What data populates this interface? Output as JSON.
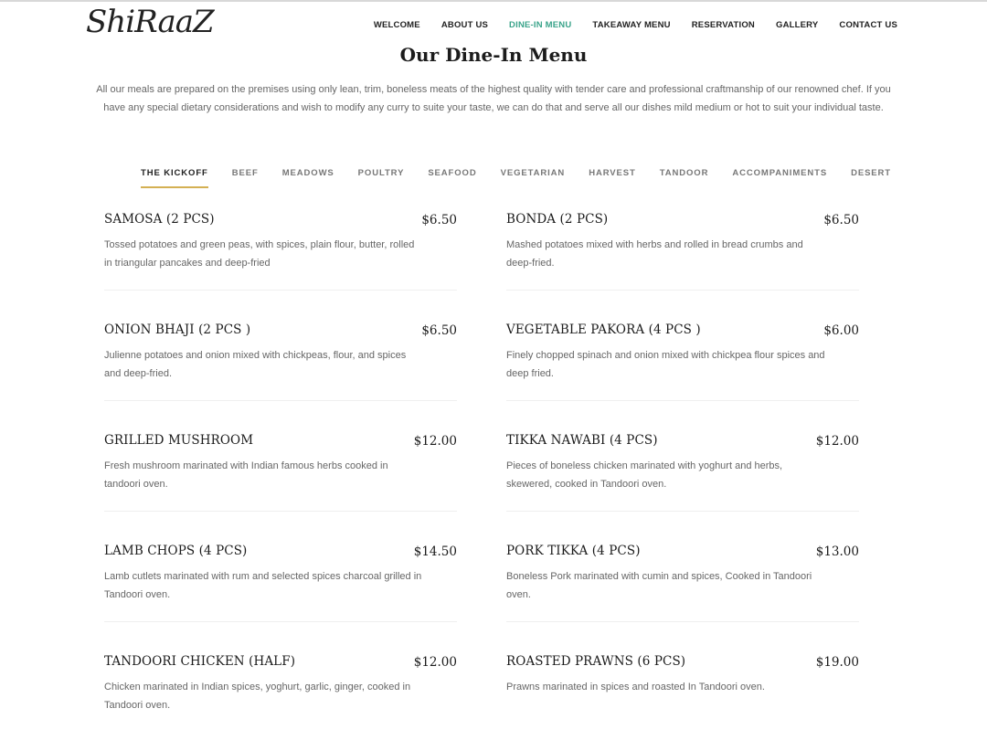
{
  "logo": "ShiRaaZ",
  "nav": [
    "WELCOME",
    "ABOUT US",
    "DINE-IN MENU",
    "TAKEAWAY MENU",
    "RESERVATION",
    "GALLERY",
    "CONTACT US"
  ],
  "nav_active": "DINE-IN MENU",
  "accent_color": "#3aa38a",
  "tab_underline_color": "#d4b053",
  "page_title": "Our Dine-In Menu",
  "intro": "All our meals are prepared on the premises using only lean, trim, boneless meats of the highest quality with tender care and professional craftmanship of our renowned chef. If you have any special dietary considerations and wish to modify any curry to suite your taste, we can do that and serve all our dishes mild medium or hot to suit your individual taste.",
  "tabs": [
    "THE KICKOFF",
    "BEEF",
    "MEADOWS",
    "POULTRY",
    "SEAFOOD",
    "VEGETARIAN",
    "HARVEST",
    "TANDOOR",
    "ACCOMPANIMENTS",
    "DESERT"
  ],
  "active_tab": "THE KICKOFF",
  "menu_items": [
    {
      "name": "SAMOSA (2 PCS)",
      "price": "$6.50",
      "desc": "Tossed potatoes and green peas, with spices, plain flour, butter, rolled in triangular pancakes and deep-fried"
    },
    {
      "name": "BONDA (2 PCS)",
      "price": "$6.50",
      "desc": "Mashed potatoes mixed with herbs and rolled in bread crumbs and deep-fried."
    },
    {
      "name": "ONION BHAJI (2 PCS )",
      "price": "$6.50",
      "desc": "Julienne potatoes and onion mixed with chickpeas, flour, and spices and deep-fried."
    },
    {
      "name": "VEGETABLE PAKORA (4 PCS )",
      "price": "$6.00",
      "desc": "Finely chopped spinach and onion mixed with chickpea flour spices and deep fried."
    },
    {
      "name": "GRILLED MUSHROOM",
      "price": "$12.00",
      "desc": "Fresh mushroom marinated with Indian famous herbs cooked in tandoori oven."
    },
    {
      "name": "TIKKA NAWABI (4 PCS)",
      "price": "$12.00",
      "desc": "Pieces of boneless chicken marinated with yoghurt and herbs, skewered, cooked in Tandoori oven."
    },
    {
      "name": "LAMB CHOPS (4 PCS)",
      "price": "$14.50",
      "desc": "Lamb cutlets marinated with rum and selected spices charcoal grilled in Tandoori oven."
    },
    {
      "name": "PORK TIKKA (4 PCS)",
      "price": "$13.00",
      "desc": "Boneless Pork marinated with cumin and spices, Cooked in Tandoori oven."
    },
    {
      "name": "TANDOORI CHICKEN (HALF)",
      "price": "$12.00",
      "desc": "Chicken marinated in Indian spices, yoghurt, garlic, ginger, cooked in Tandoori oven."
    },
    {
      "name": "ROASTED PRAWNS (6 PCS)",
      "price": "$19.00",
      "desc": "Prawns marinated in spices and roasted In Tandoori oven."
    }
  ]
}
